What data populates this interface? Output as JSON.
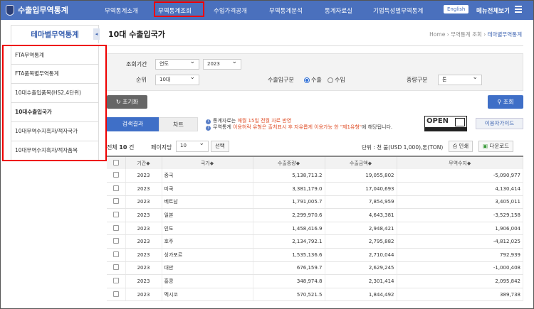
{
  "header": {
    "logo": "수출입무역통계",
    "nav": [
      "무역통계소개",
      "무역통계조회",
      "수입가격공개",
      "무역통계분석",
      "통계자료실",
      "기업특성별무역통계"
    ],
    "english": "English",
    "all_menu": "메뉴전체보기"
  },
  "sidebar": {
    "title": "테마별무역통계",
    "items": [
      "FTA무역통계",
      "FTA품목별무역통계",
      "10대수출입품목(HS2,4단위)",
      "10대수출입국가",
      "10대무역수지흑자/적자국가",
      "10대무역수지흑자/적자품목"
    ]
  },
  "page": {
    "title": "10대 수출입국가",
    "breadcrumb": [
      "Home",
      "무역통계 조회",
      "테마별무역통계"
    ]
  },
  "filter": {
    "period_label": "조회기간",
    "period_type": "연도",
    "year": "2023",
    "rank_label": "순위",
    "rank": "10대",
    "io_label": "수출입구분",
    "export": "수출",
    "import": "수입",
    "weight_label": "중량구분",
    "weight": "톤"
  },
  "buttons": {
    "reset": "초기화",
    "search": "조회",
    "guide": "이용자가이드",
    "print": "인쇄",
    "download": "다운로드",
    "select": "선택"
  },
  "tabs": [
    "검색결과",
    "차트"
  ],
  "notice": {
    "l1a": "통계자료는 ",
    "l1b": "매월 15일 전월 자료 반영",
    "l2a": "무역통계 ",
    "l2b": "이용허락 유형은 출처표시 후 자유롭게 이용가능 한 \"제1유형\"",
    "l2c": "에 해당됩니다."
  },
  "open_badge": "OPEN",
  "results": {
    "total_prefix": "전체",
    "total": "10",
    "total_suffix": "건",
    "per_page_label": "페이지당",
    "per_page": "10",
    "unit": "단위 : 천 불(USD 1,000),톤(TON)"
  },
  "table": {
    "headers": [
      "기간",
      "국가",
      "수출중량",
      "수출금액",
      "무역수지"
    ],
    "rows": [
      [
        "2023",
        "중국",
        "5,138,713.2",
        "19,055,802",
        "-5,090,977"
      ],
      [
        "2023",
        "미국",
        "3,381,179.0",
        "17,040,693",
        "4,130,414"
      ],
      [
        "2023",
        "베트남",
        "1,791,005.7",
        "7,854,959",
        "3,405,011"
      ],
      [
        "2023",
        "일본",
        "2,299,970.6",
        "4,643,381",
        "-3,529,158"
      ],
      [
        "2023",
        "인도",
        "1,458,416.9",
        "2,948,421",
        "1,906,004"
      ],
      [
        "2023",
        "호주",
        "2,134,792.1",
        "2,795,882",
        "-4,812,025"
      ],
      [
        "2023",
        "싱가포르",
        "1,535,136.6",
        "2,710,044",
        "792,939"
      ],
      [
        "2023",
        "대만",
        "676,159.7",
        "2,629,245",
        "-1,000,408"
      ],
      [
        "2023",
        "홍콩",
        "348,974.8",
        "2,301,414",
        "2,095,842"
      ],
      [
        "2023",
        "멕시코",
        "570,521.5",
        "1,844,492",
        "389,738"
      ]
    ]
  }
}
